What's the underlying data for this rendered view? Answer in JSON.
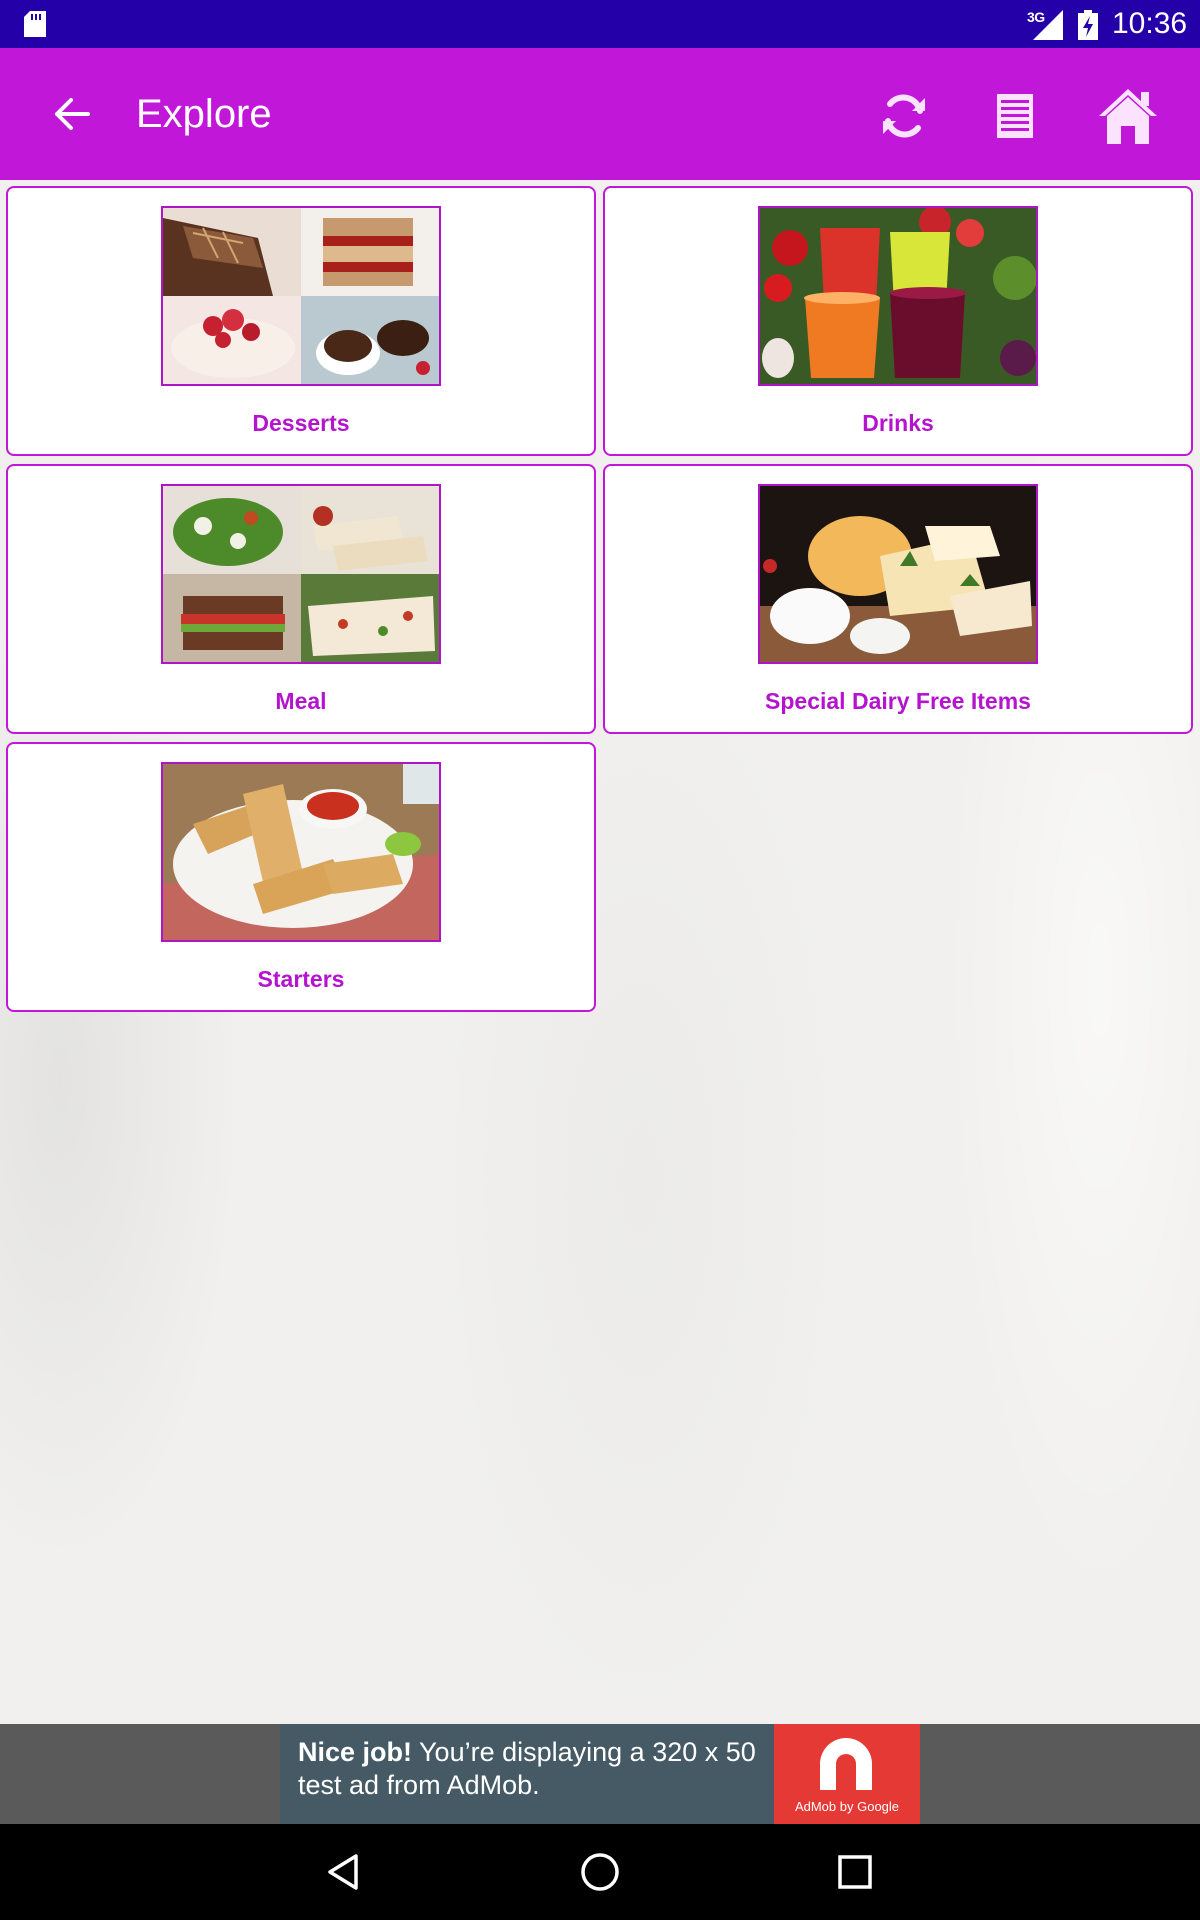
{
  "status_bar": {
    "network": "3G",
    "time": "10:36",
    "icons": [
      "sd-card-icon",
      "signal-icon",
      "battery-charging-icon"
    ]
  },
  "app_bar": {
    "title": "Explore",
    "icons": [
      "back-arrow-icon",
      "refresh-icon",
      "list-icon",
      "home-icon"
    ]
  },
  "categories": [
    {
      "label": "Desserts",
      "image": "desserts-collage"
    },
    {
      "label": "Drinks",
      "image": "juices-and-vegetables"
    },
    {
      "label": "Meal",
      "image": "meal-collage"
    },
    {
      "label": "Special Dairy Free Items",
      "image": "cheese-board"
    },
    {
      "label": "Starters",
      "image": "spring-rolls-plate"
    }
  ],
  "ad": {
    "headline": "Nice job!",
    "body": " You’re displaying a 320 x 50 test ad from AdMob.",
    "brand": "AdMob by Google",
    "colors": {
      "text_box": "#455a64",
      "logo_box": "#e53935"
    }
  },
  "nav_bar": {
    "icons": [
      "nav-back-icon",
      "nav-home-icon",
      "nav-recents-icon"
    ]
  },
  "colors": {
    "status_bar": "#2300a8",
    "app_bar": "#c017d8",
    "card_border": "#c017d8",
    "card_label": "#b514cf"
  }
}
